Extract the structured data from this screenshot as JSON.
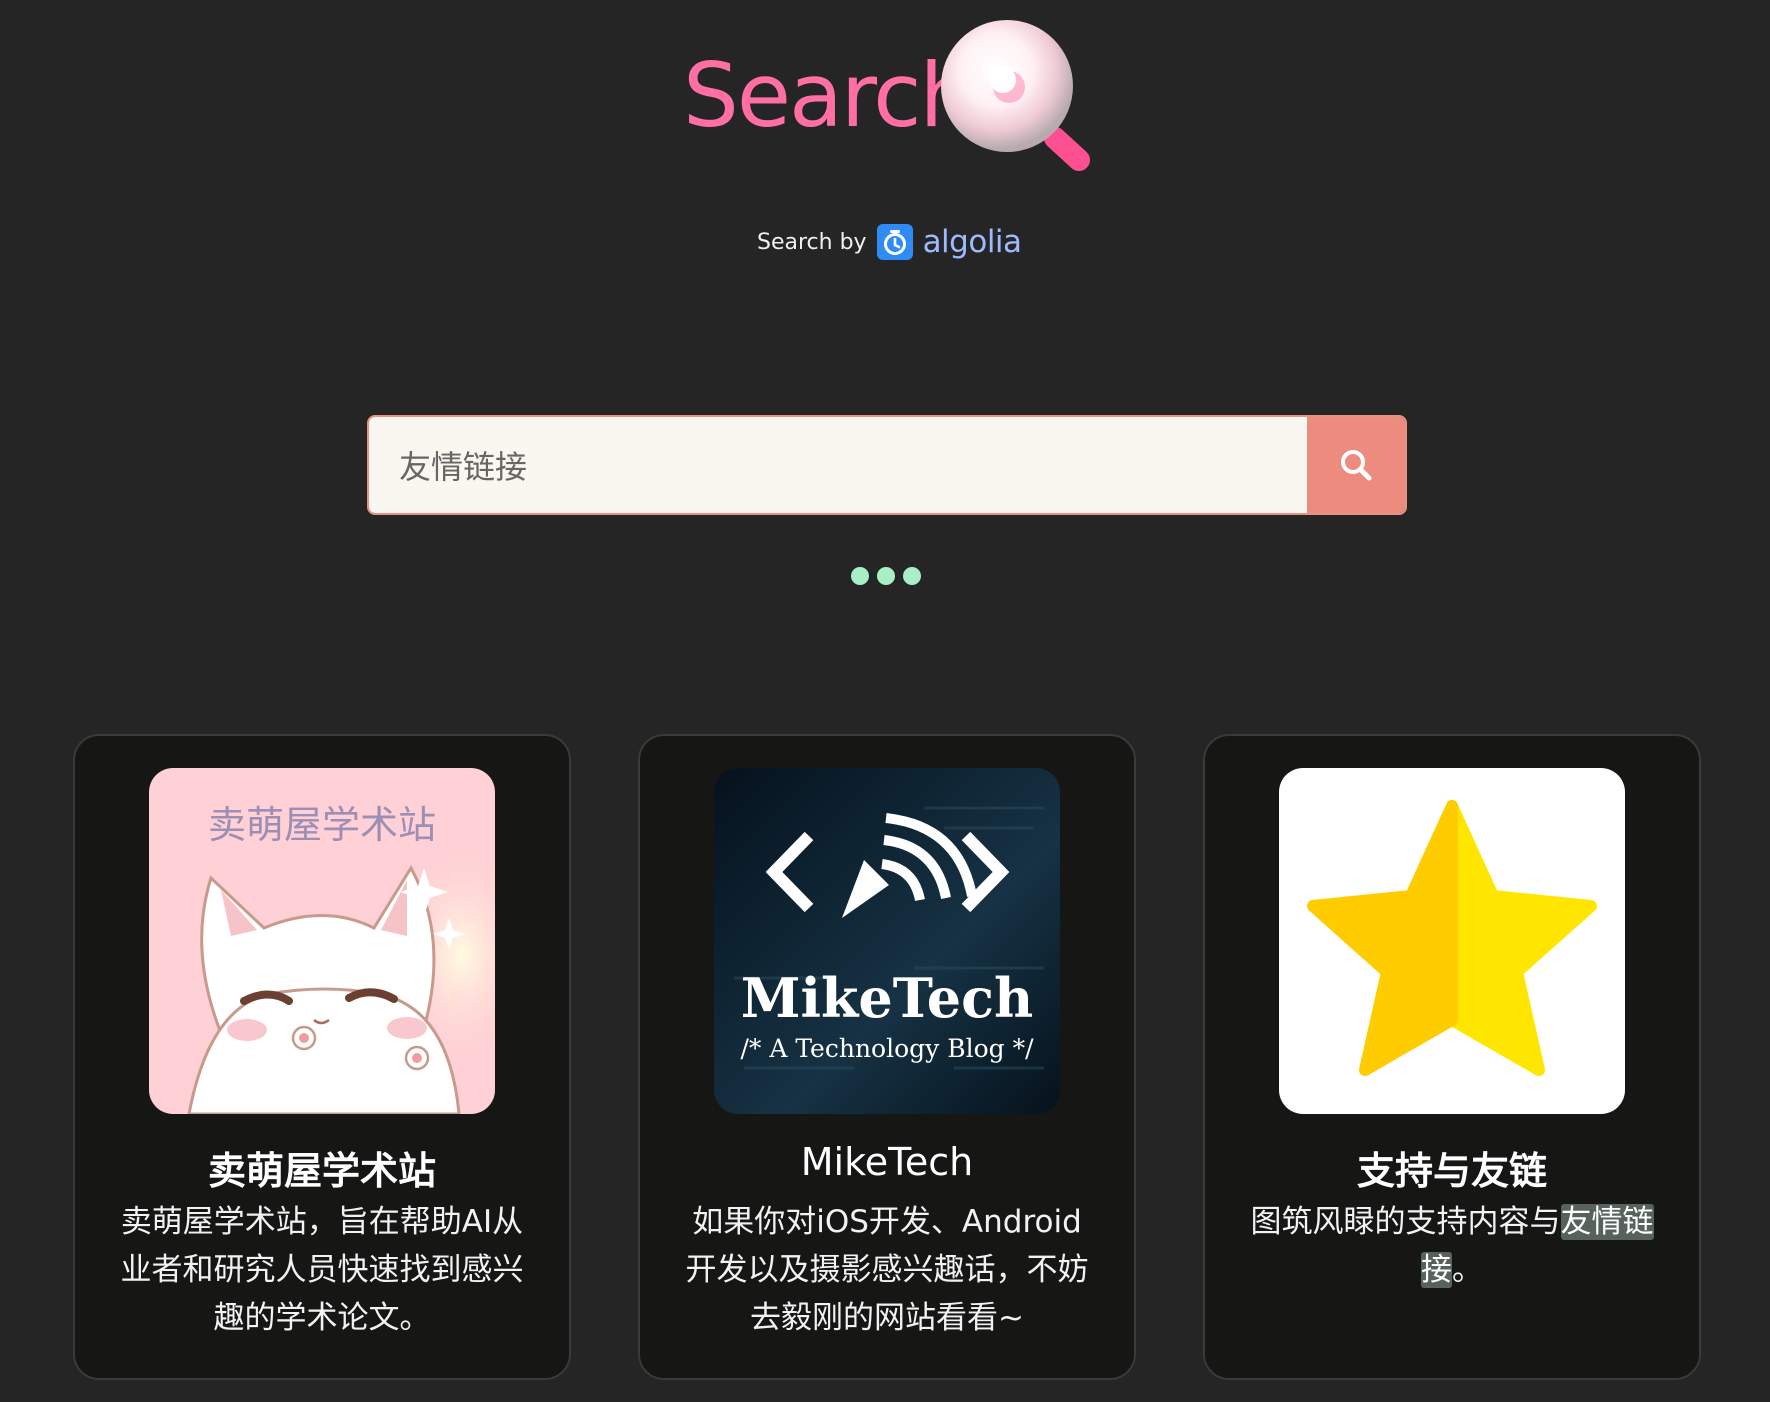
{
  "logo": {
    "text": "Search"
  },
  "powered_by": {
    "label": "Search by",
    "brand": "algolia"
  },
  "search": {
    "value": "友情链接"
  },
  "results": [
    {
      "image_text": "卖萌屋学术站",
      "title": "卖萌屋学术站",
      "description": "卖萌屋学术站，旨在帮助AI从业者和研究人员快速找到感兴趣的学术论文。"
    },
    {
      "image_text": "MikeTech",
      "image_subtext": "/* A Technology Blog */",
      "title": "MikeTech",
      "description": "如果你对iOS开发、Android开发以及摄影感兴趣话，不妨去毅刚的网站看看~"
    },
    {
      "title": "支持与友链",
      "description_before": "图筑风睩的支持内容与",
      "description_highlight_1": "友情链",
      "description_highlight_2": "接",
      "description_after": "。"
    }
  ],
  "colors": {
    "background": "#262525",
    "logo": "#ff6fa3",
    "search_button": "#ed8b7f",
    "loading_dots": "#a8efc6",
    "card_background": "#161615",
    "highlight": "#56625b"
  },
  "icons": [
    "magnifier-bubble-icon",
    "algolia-icon",
    "search-icon",
    "cat-illustration",
    "pen-signal-icon",
    "star-icon"
  ]
}
